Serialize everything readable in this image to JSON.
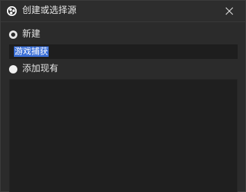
{
  "window": {
    "title": "创建或选择源",
    "icon": "obs-logo-icon",
    "close_icon": "close-icon"
  },
  "options": {
    "new_label": "新建",
    "new_selected": true,
    "existing_label": "添加现有",
    "existing_selected": false
  },
  "name_input": {
    "value": "游戏捕获",
    "selected": true
  },
  "existing_list": {
    "items": []
  },
  "colors": {
    "background": "#2b2b2b",
    "input_background": "#1e1e1e",
    "selection": "#3b6fd6"
  }
}
